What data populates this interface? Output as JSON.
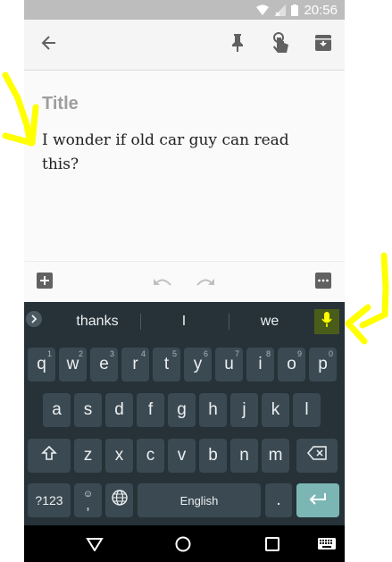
{
  "status": {
    "time": "20:56"
  },
  "note": {
    "title_placeholder": "Title",
    "body": "I wonder if old car guy can read this?"
  },
  "keyboard": {
    "suggestions": [
      "thanks",
      "I",
      "we"
    ],
    "rows": [
      [
        {
          "k": "q",
          "h": "1"
        },
        {
          "k": "w",
          "h": "2"
        },
        {
          "k": "e",
          "h": "3"
        },
        {
          "k": "r",
          "h": "4"
        },
        {
          "k": "t",
          "h": "5"
        },
        {
          "k": "y",
          "h": "6"
        },
        {
          "k": "u",
          "h": "7"
        },
        {
          "k": "i",
          "h": "8"
        },
        {
          "k": "o",
          "h": "9"
        },
        {
          "k": "p",
          "h": "0"
        }
      ],
      [
        {
          "k": "a"
        },
        {
          "k": "s"
        },
        {
          "k": "d"
        },
        {
          "k": "f"
        },
        {
          "k": "g"
        },
        {
          "k": "h"
        },
        {
          "k": "j"
        },
        {
          "k": "k"
        },
        {
          "k": "l"
        }
      ],
      [
        {
          "k": "z"
        },
        {
          "k": "x"
        },
        {
          "k": "c"
        },
        {
          "k": "v"
        },
        {
          "k": "b"
        },
        {
          "k": "n"
        },
        {
          "k": "m"
        }
      ]
    ],
    "symbols_label": "?123",
    "space_label": "English",
    "period_label": ".",
    "comma_label": ","
  },
  "colors": {
    "annotation": "#ffff00",
    "keyboard_bg": "#263238",
    "key_bg": "#3b4a52",
    "enter_key": "#7bb6b5",
    "mic_highlight": "#4a5c1a"
  },
  "icons": {
    "toolbar": [
      "back-arrow-icon",
      "pin-icon",
      "reminder-hand-icon",
      "archive-icon"
    ],
    "note_bottom": [
      "add-box-icon",
      "undo-icon",
      "redo-icon",
      "more-icon"
    ],
    "keyboard": [
      "chevron-right-icon",
      "microphone-icon",
      "shift-icon",
      "backspace-icon",
      "emoji-icon",
      "globe-icon",
      "enter-icon"
    ],
    "nav": [
      "back-triangle-icon",
      "home-circle-icon",
      "recents-square-icon",
      "keyboard-switch-icon"
    ]
  }
}
